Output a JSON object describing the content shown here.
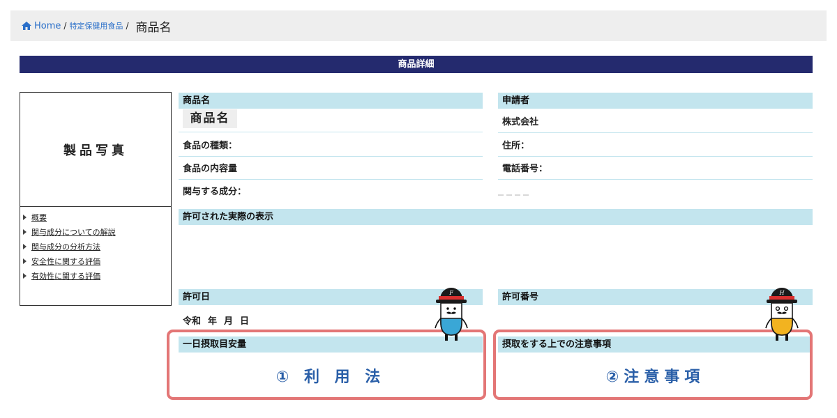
{
  "breadcrumb": {
    "home": "Home",
    "sep": "/",
    "category": "特定保健用食品",
    "current": "商品名"
  },
  "title_bar": "商品詳細",
  "photo_label": "製品写真",
  "nav_items": [
    "概要",
    "関与成分についての解説",
    "関与成分の分析方法",
    "安全性に関する評価",
    "有効性に関する評価"
  ],
  "product": {
    "header": "商品名",
    "name": "商品名",
    "food_type": "食品の種類：",
    "content_volume": "食品の内容量",
    "ingredient": "関与する成分："
  },
  "applicant": {
    "header": "申請者",
    "company": "株式会社",
    "address": "住所：",
    "phone": "電話番号："
  },
  "display": {
    "header": "許可された実際の表示"
  },
  "permit_date": {
    "header": "許可日",
    "era": "令和",
    "year": "年",
    "month": "月",
    "day": "日"
  },
  "permit_number": {
    "header": "許可番号"
  },
  "daily_intake": {
    "header": "一日摂取目安量",
    "callout": "① 利 用 法"
  },
  "precautions": {
    "header": "摂取をする上での注意事項",
    "callout": "②注意事項"
  },
  "mascots": {
    "left": {
      "hat_letter": "F",
      "body_color": "#3aa7d6"
    },
    "right": {
      "hat_letter": "H",
      "body_color": "#f2b320"
    }
  },
  "colors": {
    "title_bar": "#242a6e",
    "section_header": "#c3e5ee",
    "highlight": "#e37676",
    "callout_text": "#2a5fa8",
    "link": "#2a6fc9"
  }
}
